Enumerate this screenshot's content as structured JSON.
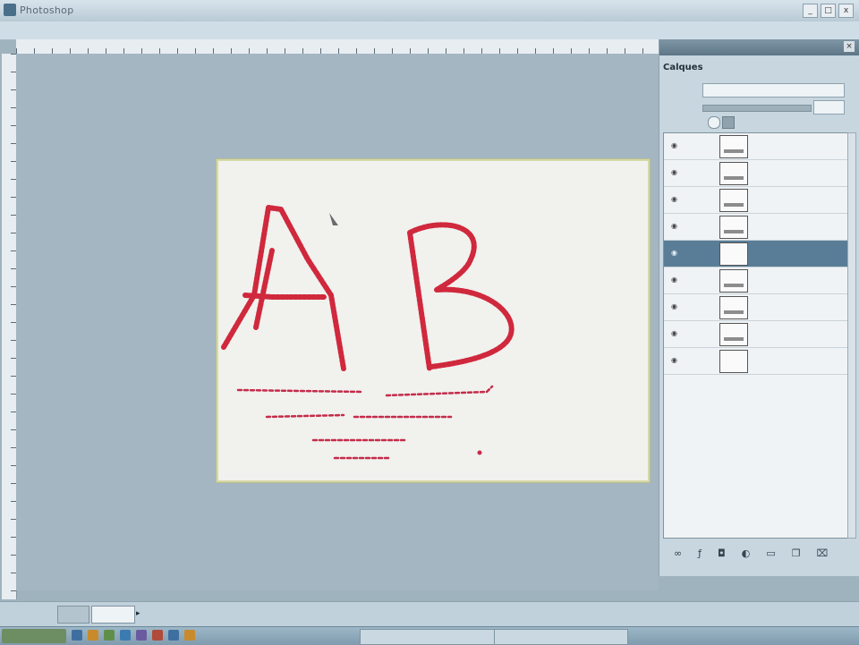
{
  "window": {
    "title": "Photoshop",
    "buttons": [
      "_",
      "□",
      "x"
    ]
  },
  "menu": [],
  "layers_panel": {
    "tab_title": "Calques",
    "header_title": "",
    "blend_label": "",
    "blend_mode": "",
    "opacity_label": "",
    "opacity_value": "",
    "lock_label": "",
    "layers": [
      {
        "name": "",
        "selected": false
      },
      {
        "name": "",
        "selected": false
      },
      {
        "name": "",
        "selected": false
      },
      {
        "name": "",
        "selected": false
      },
      {
        "name": "",
        "selected": true
      },
      {
        "name": "",
        "selected": false
      },
      {
        "name": "",
        "selected": false
      },
      {
        "name": "",
        "selected": false
      },
      {
        "name": "",
        "selected": false
      }
    ],
    "footer_icons": [
      "link-icon",
      "fx-icon",
      "mask-icon",
      "adjustment-icon",
      "folder-icon",
      "new-layer-icon",
      "trash-icon"
    ]
  },
  "document": {
    "big_letters": "AB",
    "accent_color": "#d0283c"
  },
  "statusbar": {
    "zoom": "",
    "doc_info": "",
    "message": ""
  },
  "taskbar": {
    "start_label": "",
    "tasks": [
      "",
      ""
    ],
    "clock": ""
  }
}
